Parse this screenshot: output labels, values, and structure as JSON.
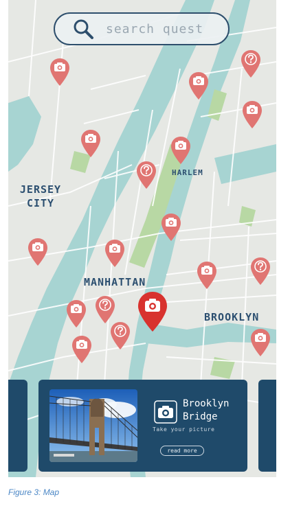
{
  "search": {
    "placeholder": "search quest",
    "icon": "search-icon"
  },
  "map": {
    "labels": {
      "jersey_city": "JERSEY CITY",
      "harlem": "HARLEM",
      "manhattan": "MANHATTAN",
      "brooklyn": "BROOKLYN"
    },
    "colors": {
      "water": "#a7d4d2",
      "land": "#e6e8e4",
      "park": "#b8d8a4",
      "pin": "#e07572",
      "pin_selected": "#d8322e"
    },
    "pins": [
      {
        "kind": "camera"
      },
      {
        "kind": "question"
      },
      {
        "kind": "camera"
      },
      {
        "kind": "camera"
      },
      {
        "kind": "camera"
      },
      {
        "kind": "camera"
      },
      {
        "kind": "question"
      },
      {
        "kind": "camera"
      },
      {
        "kind": "camera"
      },
      {
        "kind": "camera"
      },
      {
        "kind": "camera"
      },
      {
        "kind": "question"
      },
      {
        "kind": "question"
      },
      {
        "kind": "camera"
      },
      {
        "kind": "question"
      },
      {
        "kind": "camera"
      },
      {
        "kind": "camera"
      },
      {
        "kind": "camera"
      }
    ],
    "selected_pin": {
      "kind": "camera"
    }
  },
  "card": {
    "title": "Brooklyn Bridge",
    "subtitle": "Take your picture",
    "read_more": "read more",
    "icon": "camera-icon",
    "card_color": "#1f4a6a"
  },
  "caption": "Figure 3: Map"
}
